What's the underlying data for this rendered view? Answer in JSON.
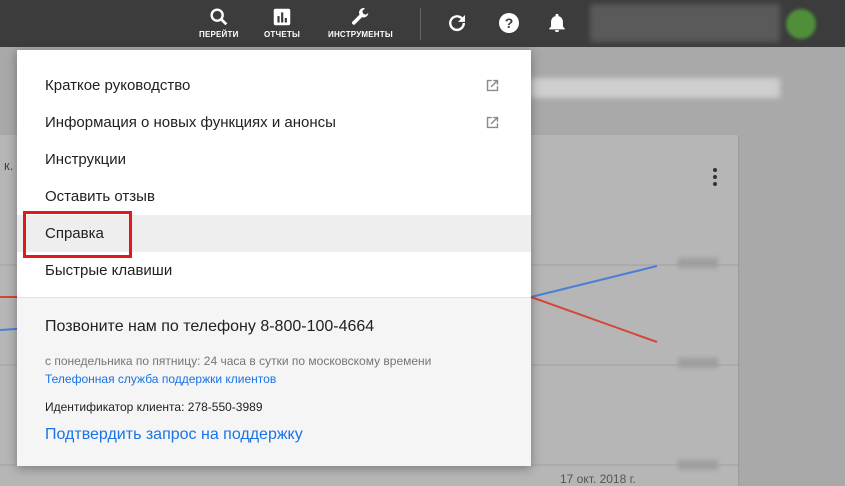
{
  "topbar": {
    "nav": [
      {
        "label": "ПЕРЕЙТИ",
        "icon": "search-icon"
      },
      {
        "label": "ОТЧЕТЫ",
        "icon": "reports-icon"
      },
      {
        "label": "ИНСТРУМЕНТЫ",
        "icon": "wrench-icon"
      }
    ],
    "icons": [
      "refresh-icon",
      "help-icon",
      "bell-icon"
    ]
  },
  "page": {
    "card_fragment": "к.",
    "date_label": "17 окт. 2018 г."
  },
  "menu": {
    "items": [
      {
        "label": "Краткое руководство",
        "external": true
      },
      {
        "label": "Информация о новых функциях и анонсы",
        "external": true
      },
      {
        "label": "Инструкции",
        "external": false
      },
      {
        "label": "Оставить отзыв",
        "external": false
      },
      {
        "label": "Справка",
        "external": false,
        "highlighted": true
      },
      {
        "label": "Быстрые клавиши",
        "external": false
      }
    ],
    "support": {
      "call": "Позвоните нам по телефону 8-800-100-4664",
      "hours": "с понедельника по пятницу: 24 часа в сутки по московскому времени",
      "support_link": "Телефонная служба поддержки клиентов",
      "client_id": "Идентификатор клиента: 278-550-3989",
      "confirm_link": "Подтвердить запрос на поддержку"
    }
  },
  "colors": {
    "accent_link": "#1a73e8",
    "highlight_border": "#e0191f",
    "chart_blue": "#4a7fd6",
    "chart_red": "#d6453a"
  }
}
